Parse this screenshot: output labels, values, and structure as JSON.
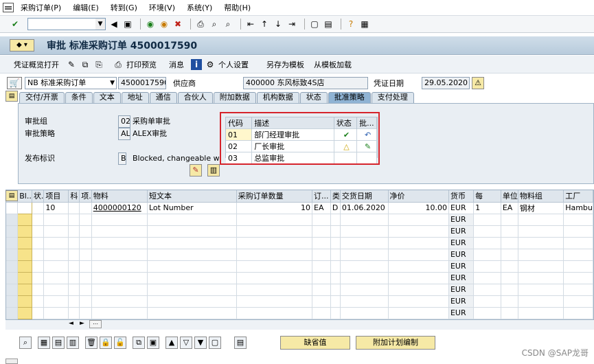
{
  "menu": [
    "采购订单(P)",
    "编辑(E)",
    "转到(G)",
    "环境(V)",
    "系统(Y)",
    "帮助(H)"
  ],
  "title": "审批 标准采购订单 4500017590",
  "apptoolbar": {
    "doc_overview": "凭证概览打开",
    "print_preview": "打印预览",
    "messages": "消息",
    "personal_settings": "个人设置",
    "save_as_template": "另存为模板",
    "load_from_template": "从模板加载"
  },
  "header": {
    "doc_type": "NB 标准采购订单",
    "po_number": "4500017590",
    "vendor_label": "供应商",
    "vendor_value": "400000 东风标致4S店",
    "doc_date_label": "凭证日期",
    "doc_date_value": "29.05.2020"
  },
  "tabs": [
    "交付/开票",
    "条件",
    "文本",
    "地址",
    "通信",
    "合伙人",
    "附加数据",
    "机构数据",
    "状态",
    "批准策略",
    "支付处理"
  ],
  "release": {
    "group_label": "审批组",
    "group_code": "02",
    "group_text": "采购单审批",
    "strategy_label": "审批策略",
    "strategy_code": "AL",
    "strategy_text": "ALEX审批",
    "indicator_label": "发布标识",
    "indicator_code": "B",
    "indicator_text": "Blocked, changeable with v..."
  },
  "approval": {
    "headers": [
      "代码",
      "描述",
      "状态",
      "批..."
    ],
    "rows": [
      {
        "code": "01",
        "desc": "部门经理审批"
      },
      {
        "code": "02",
        "desc": "厂长审批"
      },
      {
        "code": "03",
        "desc": "总监审批"
      }
    ]
  },
  "items": {
    "headers": [
      "Bl..",
      "状.",
      "项目",
      "科",
      "项.",
      "物料",
      "短文本",
      "采购订单数量",
      "订...",
      "类",
      "交货日期",
      "净价",
      "货币",
      "每",
      "单位",
      "物料组",
      "工厂"
    ],
    "row1": {
      "item": "10",
      "material": "4000000120",
      "short_text": "Lot Number",
      "qty": "10",
      "unit": "EA",
      "d": "D",
      "date": "01.06.2020",
      "price": "10.00",
      "currency": "EUR",
      "per": "1",
      "unit2": "EA",
      "matgroup": "钢材",
      "plant": "Hambu"
    },
    "empty_currency": "EUR"
  },
  "buttons": {
    "default_values": "缺省值",
    "additional_planning": "附加计划编制"
  },
  "watermark": "CSDN @SAP龙哥"
}
